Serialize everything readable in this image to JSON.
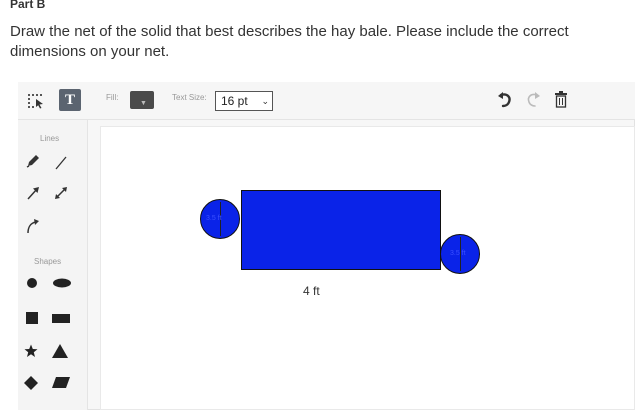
{
  "question": {
    "part": "Part B",
    "text": "Draw the net of the solid that best describes the hay bale. Please include the correct dimensions on your net."
  },
  "toolbar": {
    "text_tool_label": "T",
    "fill_label": "Fill:",
    "text_size_label": "Text Size:",
    "text_size_value": "16 pt",
    "icons": [
      "select-icon",
      "text-icon",
      "undo-icon",
      "redo-icon",
      "trash-icon"
    ]
  },
  "sidebar": {
    "lines_label": "Lines",
    "shapes_label": "Shapes"
  },
  "canvas": {
    "fill_color": "#0a23e8",
    "left_circle_label": "3.5 ft",
    "right_circle_label": "3.5 ft",
    "length_label": "4 ft"
  }
}
